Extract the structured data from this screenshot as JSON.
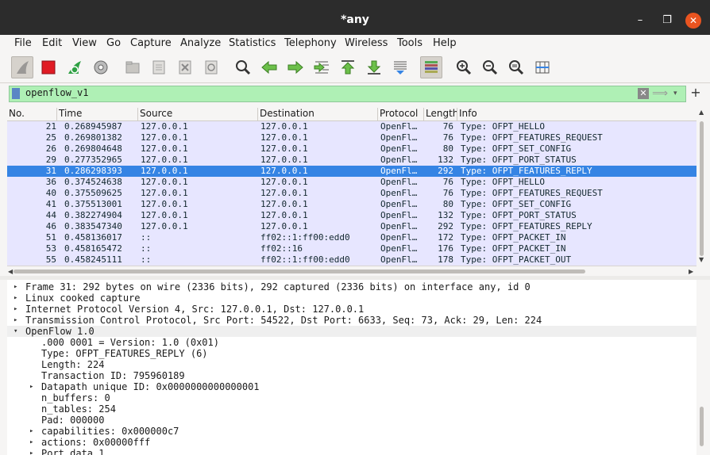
{
  "window": {
    "title": "*any",
    "minimize": "–",
    "maximize": "❐",
    "close": "✕"
  },
  "menu": [
    "File",
    "Edit",
    "View",
    "Go",
    "Capture",
    "Analyze",
    "Statistics",
    "Telephony",
    "Wireless",
    "Tools",
    "Help"
  ],
  "toolbar": {
    "icons": [
      "shark-fin-icon",
      "stop-capture-icon",
      "restart-capture-icon",
      "capture-options-icon",
      "open-file-icon",
      "save-file-icon",
      "close-file-icon",
      "reload-file-icon",
      "find-packet-icon",
      "go-back-icon",
      "go-forward-icon",
      "go-to-packet-icon",
      "first-packet-icon",
      "last-packet-icon",
      "autoscroll-icon",
      "colorize-icon",
      "zoom-in-icon",
      "zoom-out-icon",
      "normal-size-icon",
      "resize-columns-icon"
    ]
  },
  "filter": {
    "value": "openflow_v1",
    "clear": "✕",
    "apply": "⟹",
    "dropdown": "▾",
    "add": "+"
  },
  "packet_list": {
    "columns": [
      "No.",
      "Time",
      "Source",
      "Destination",
      "Protocol",
      "Length",
      "Info"
    ],
    "rows": [
      {
        "no": "21",
        "time": "0.268945987",
        "src": "127.0.0.1",
        "dst": "127.0.0.1",
        "proto": "OpenFl…",
        "len": "76",
        "info": "Type: OFPT_HELLO"
      },
      {
        "no": "25",
        "time": "0.269801382",
        "src": "127.0.0.1",
        "dst": "127.0.0.1",
        "proto": "OpenFl…",
        "len": "76",
        "info": "Type: OFPT_FEATURES_REQUEST"
      },
      {
        "no": "26",
        "time": "0.269804648",
        "src": "127.0.0.1",
        "dst": "127.0.0.1",
        "proto": "OpenFl…",
        "len": "80",
        "info": "Type: OFPT_SET_CONFIG"
      },
      {
        "no": "29",
        "time": "0.277352965",
        "src": "127.0.0.1",
        "dst": "127.0.0.1",
        "proto": "OpenFl…",
        "len": "132",
        "info": "Type: OFPT_PORT_STATUS"
      },
      {
        "no": "31",
        "time": "0.286298393",
        "src": "127.0.0.1",
        "dst": "127.0.0.1",
        "proto": "OpenFl…",
        "len": "292",
        "info": "Type: OFPT_FEATURES_REPLY"
      },
      {
        "no": "36",
        "time": "0.374524638",
        "src": "127.0.0.1",
        "dst": "127.0.0.1",
        "proto": "OpenFl…",
        "len": "76",
        "info": "Type: OFPT_HELLO"
      },
      {
        "no": "40",
        "time": "0.375509625",
        "src": "127.0.0.1",
        "dst": "127.0.0.1",
        "proto": "OpenFl…",
        "len": "76",
        "info": "Type: OFPT_FEATURES_REQUEST"
      },
      {
        "no": "41",
        "time": "0.375513001",
        "src": "127.0.0.1",
        "dst": "127.0.0.1",
        "proto": "OpenFl…",
        "len": "80",
        "info": "Type: OFPT_SET_CONFIG"
      },
      {
        "no": "44",
        "time": "0.382274904",
        "src": "127.0.0.1",
        "dst": "127.0.0.1",
        "proto": "OpenFl…",
        "len": "132",
        "info": "Type: OFPT_PORT_STATUS"
      },
      {
        "no": "46",
        "time": "0.383547340",
        "src": "127.0.0.1",
        "dst": "127.0.0.1",
        "proto": "OpenFl…",
        "len": "292",
        "info": "Type: OFPT_FEATURES_REPLY"
      },
      {
        "no": "51",
        "time": "0.458136017",
        "src": "::",
        "dst": "ff02::1:ff00:edd0",
        "proto": "OpenFl…",
        "len": "172",
        "info": "Type: OFPT_PACKET_IN"
      },
      {
        "no": "53",
        "time": "0.458165472",
        "src": "::",
        "dst": "ff02::16",
        "proto": "OpenFl…",
        "len": "176",
        "info": "Type: OFPT_PACKET_IN"
      },
      {
        "no": "55",
        "time": "0.458245111",
        "src": "::",
        "dst": "ff02::1:ff00:edd0",
        "proto": "OpenFl…",
        "len": "178",
        "info": "Type: OFPT_PACKET_OUT"
      }
    ],
    "selected_no": "31"
  },
  "details": [
    {
      "text": "Frame 31: 292 bytes on wire (2336 bits), 292 captured (2336 bits) on interface any, id 0",
      "tri": "▸",
      "level": 0
    },
    {
      "text": "Linux cooked capture",
      "tri": "▸",
      "level": 0
    },
    {
      "text": "Internet Protocol Version 4, Src: 127.0.0.1, Dst: 127.0.0.1",
      "tri": "▸",
      "level": 0
    },
    {
      "text": "Transmission Control Protocol, Src Port: 54522, Dst Port: 6633, Seq: 73, Ack: 29, Len: 224",
      "tri": "▸",
      "level": 0
    },
    {
      "text": "OpenFlow 1.0",
      "tri": "▾",
      "level": 0
    },
    {
      "text": ".000 0001 = Version: 1.0 (0x01)",
      "tri": "",
      "level": 1
    },
    {
      "text": "Type: OFPT_FEATURES_REPLY (6)",
      "tri": "",
      "level": 1
    },
    {
      "text": "Length: 224",
      "tri": "",
      "level": 1
    },
    {
      "text": "Transaction ID: 795960189",
      "tri": "",
      "level": 1
    },
    {
      "text": "Datapath unique ID: 0x0000000000000001",
      "tri": "▸",
      "level": 1
    },
    {
      "text": "n_buffers: 0",
      "tri": "",
      "level": 1
    },
    {
      "text": "n_tables: 254",
      "tri": "",
      "level": 1
    },
    {
      "text": "Pad: 000000",
      "tri": "",
      "level": 1
    },
    {
      "text": "capabilities: 0x000000c7",
      "tri": "▸",
      "level": 1
    },
    {
      "text": "actions: 0x00000fff",
      "tri": "▸",
      "level": 1
    },
    {
      "text": "Port data 1",
      "tri": "▸",
      "level": 1
    }
  ]
}
